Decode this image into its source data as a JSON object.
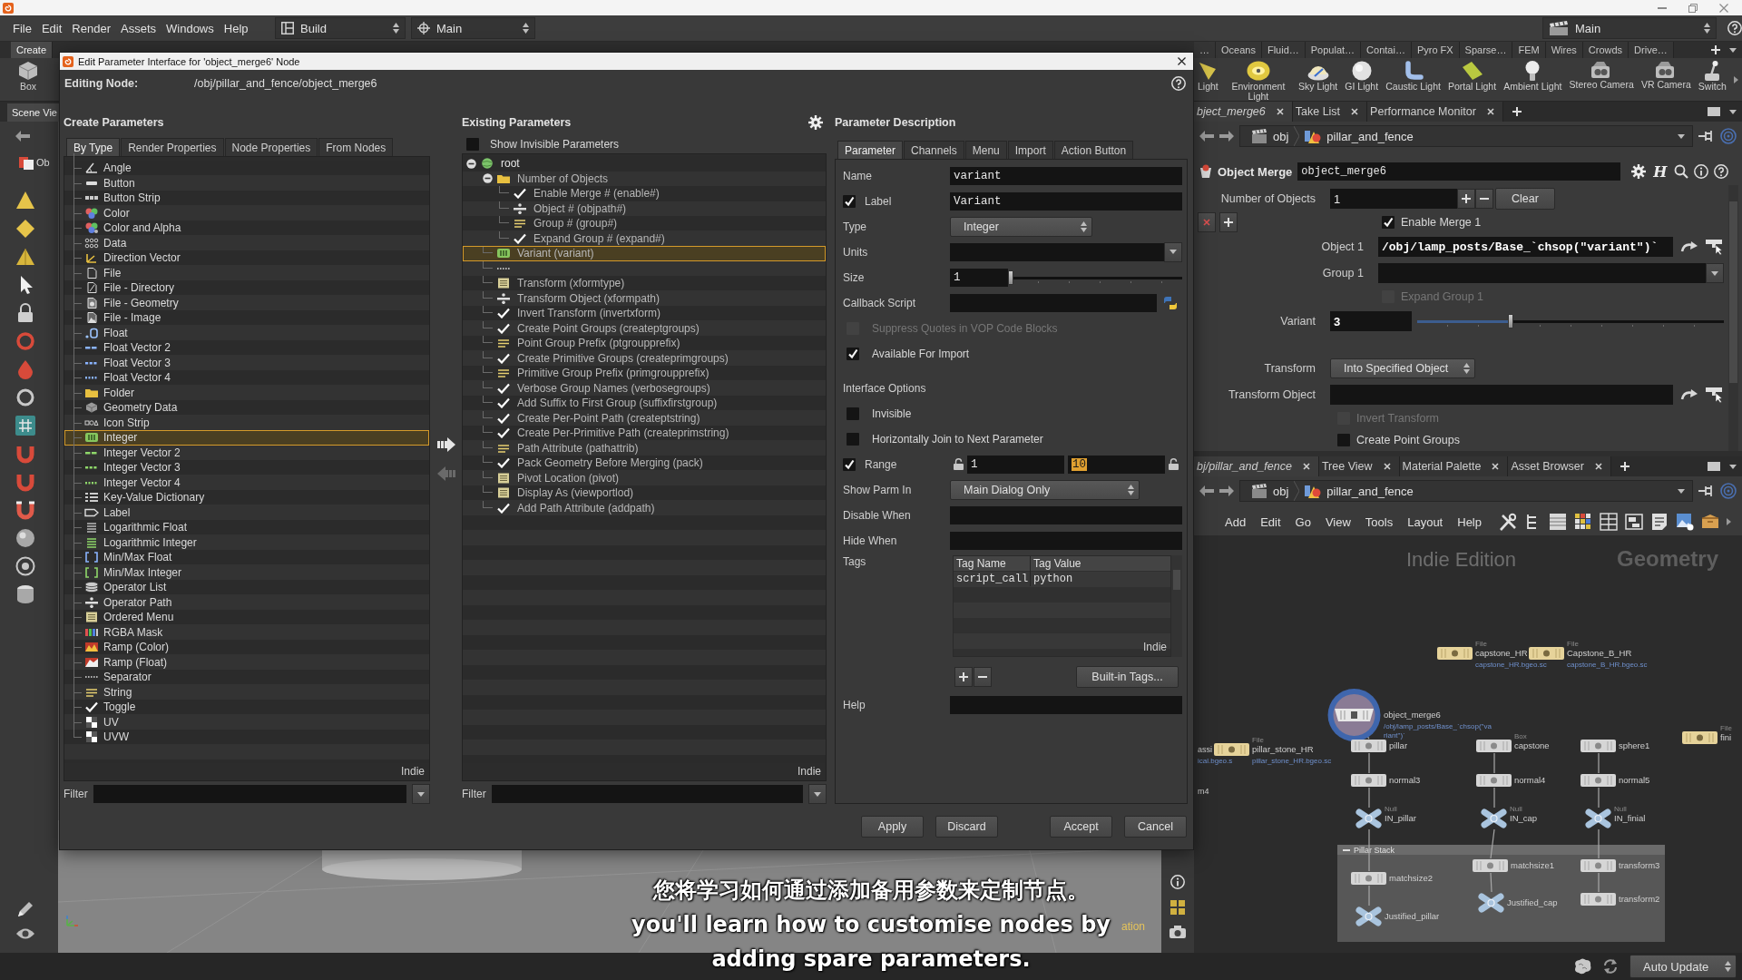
{
  "menu_bar": {
    "menus": [
      "File",
      "Edit",
      "Render",
      "Assets",
      "Windows",
      "Help"
    ],
    "desktop_selectors": [
      {
        "label": "Build",
        "kind": "layout"
      },
      {
        "label": "Main",
        "kind": "target"
      }
    ],
    "desktop_menu": {
      "label": "Main"
    }
  },
  "shelf": {
    "left_tabs": [
      {
        "label": "Create",
        "selected": true
      }
    ],
    "left_tools": [
      {
        "label": "Box",
        "kind": "box"
      }
    ],
    "tabs": [
      {
        "label": "…",
        "selected": false
      },
      {
        "label": "Oceans",
        "selected": false
      },
      {
        "label": "Fluid…",
        "selected": false
      },
      {
        "label": "Populat…",
        "selected": false
      },
      {
        "label": "Contai…",
        "selected": false
      },
      {
        "label": "Pyro FX",
        "selected": false
      },
      {
        "label": "Sparse…",
        "selected": false
      },
      {
        "label": "FEM",
        "selected": false
      },
      {
        "label": "Wires",
        "selected": false
      },
      {
        "label": "Crowds",
        "selected": false
      },
      {
        "label": "Drive…",
        "selected": false
      }
    ],
    "tools": [
      {
        "label": "Light",
        "kind": "cone"
      },
      {
        "label": "Environment Light",
        "kind": "disc"
      },
      {
        "label": "Sky Light",
        "kind": "dome"
      },
      {
        "label": "GI Light",
        "kind": "sphere"
      },
      {
        "label": "Caustic Light",
        "kind": "tube"
      },
      {
        "label": "Portal Light",
        "kind": "panel"
      },
      {
        "label": "Ambient Light",
        "kind": "bulb"
      },
      {
        "label": "Stereo Camera",
        "kind": "camera"
      },
      {
        "label": "VR Camera",
        "kind": "camera"
      },
      {
        "label": "Switch",
        "kind": "lever"
      }
    ]
  },
  "scene_view": {
    "tabs": [
      {
        "label": "Scene Vie",
        "selected": true
      }
    ],
    "context_button": "Ob",
    "hud_text": "ation"
  },
  "dialog": {
    "title": "Edit Parameter Interface for 'object_merge6' Node",
    "editing_node_label": "Editing Node:",
    "editing_node_path": "/obj/pillar_and_fence/object_merge6",
    "create_parameters": {
      "heading": "Create Parameters",
      "tabs": [
        {
          "label": "By Type",
          "selected": true
        },
        {
          "label": "Render Properties",
          "selected": false
        },
        {
          "label": "Node Properties",
          "selected": false
        },
        {
          "label": "From Nodes",
          "selected": false
        }
      ],
      "items": [
        {
          "label": "Angle",
          "kind": "angle",
          "selected": false
        },
        {
          "label": "Button",
          "kind": "button",
          "selected": false
        },
        {
          "label": "Button Strip",
          "kind": "strip",
          "selected": false
        },
        {
          "label": "Color",
          "kind": "color",
          "selected": false
        },
        {
          "label": "Color and Alpha",
          "kind": "alpha",
          "selected": false
        },
        {
          "label": "Data",
          "kind": "data",
          "selected": false
        },
        {
          "label": "Direction Vector",
          "kind": "direction",
          "selected": false
        },
        {
          "label": "File",
          "kind": "file",
          "selected": false
        },
        {
          "label": "File - Directory",
          "kind": "directory",
          "selected": false
        },
        {
          "label": "File - Geometry",
          "kind": "geofile",
          "selected": false
        },
        {
          "label": "File - Image",
          "kind": "image",
          "selected": false
        },
        {
          "label": "Float",
          "kind": "float",
          "selected": false
        },
        {
          "label": "Float Vector 2",
          "kind": "fvec2",
          "selected": false
        },
        {
          "label": "Float Vector 3",
          "kind": "fvec3",
          "selected": false
        },
        {
          "label": "Float Vector 4",
          "kind": "fvec4",
          "selected": false
        },
        {
          "label": "Folder",
          "kind": "folder",
          "selected": false
        },
        {
          "label": "Geometry Data",
          "kind": "geodata",
          "selected": false
        },
        {
          "label": "Icon Strip",
          "kind": "iconstrip",
          "selected": false
        },
        {
          "label": "Integer",
          "kind": "integer",
          "selected": true
        },
        {
          "label": "Integer Vector 2",
          "kind": "ivec2",
          "selected": false
        },
        {
          "label": "Integer Vector 3",
          "kind": "ivec3",
          "selected": false
        },
        {
          "label": "Integer Vector 4",
          "kind": "ivec4",
          "selected": false
        },
        {
          "label": "Key-Value Dictionary",
          "kind": "dict",
          "selected": false
        },
        {
          "label": "Label",
          "kind": "label",
          "selected": false
        },
        {
          "label": "Logarithmic Float",
          "kind": "logfloat",
          "selected": false
        },
        {
          "label": "Logarithmic Integer",
          "kind": "logint",
          "selected": false
        },
        {
          "label": "Min/Max Float",
          "kind": "minmaxf",
          "selected": false
        },
        {
          "label": "Min/Max Integer",
          "kind": "minmaxi",
          "selected": false
        },
        {
          "label": "Operator List",
          "kind": "oplist",
          "selected": false
        },
        {
          "label": "Operator Path",
          "kind": "oppath",
          "selected": false
        },
        {
          "label": "Ordered Menu",
          "kind": "menu",
          "selected": false
        },
        {
          "label": "RGBA Mask",
          "kind": "rgba",
          "selected": false
        },
        {
          "label": "Ramp (Color)",
          "kind": "rampcolor",
          "selected": false
        },
        {
          "label": "Ramp (Float)",
          "kind": "rampfloat",
          "selected": false
        },
        {
          "label": "Separator",
          "kind": "separator",
          "selected": false
        },
        {
          "label": "String",
          "kind": "string",
          "selected": false
        },
        {
          "label": "Toggle",
          "kind": "toggle",
          "selected": false
        },
        {
          "label": "UV",
          "kind": "uv",
          "selected": false
        },
        {
          "label": "UVW",
          "kind": "uv",
          "selected": false
        }
      ],
      "edition_mark": "Indie",
      "filter_label": "Filter"
    },
    "existing_parameters": {
      "heading": "Existing Parameters",
      "show_invisible": {
        "label": "Show Invisible Parameters",
        "checked": false
      },
      "tree": [
        {
          "label": "root",
          "kind": "root",
          "expanded": true,
          "selected": false,
          "children": [
            {
              "label": "Number of Objects",
              "kind": "folder",
              "expanded": true,
              "selected": false,
              "children": [
                {
                  "label": "Enable Merge # (enable#)",
                  "kind": "toggle",
                  "selected": false
                },
                {
                  "label": "Object # (objpath#)",
                  "kind": "oppath",
                  "selected": false
                },
                {
                  "label": "Group # (group#)",
                  "kind": "string",
                  "selected": false
                },
                {
                  "label": "Expand Group # (expand#)",
                  "kind": "toggle",
                  "selected": false
                }
              ]
            },
            {
              "label": "Variant (variant)",
              "kind": "integer",
              "selected": true
            },
            {
              "kind": "separator",
              "selected": false
            },
            {
              "label": "Transform (xformtype)",
              "kind": "menu",
              "selected": false
            },
            {
              "label": "Transform Object (xformpath)",
              "kind": "oppath",
              "selected": false
            },
            {
              "label": "Invert Transform (invertxform)",
              "kind": "toggle",
              "selected": false
            },
            {
              "label": "Create Point Groups (createptgroups)",
              "kind": "toggle",
              "selected": false
            },
            {
              "label": "Point Group Prefix (ptgroupprefix)",
              "kind": "string",
              "selected": false
            },
            {
              "label": "Create Primitive Groups (createprimgroups)",
              "kind": "toggle",
              "selected": false
            },
            {
              "label": "Primitive Group Prefix (primgroupprefix)",
              "kind": "string",
              "selected": false
            },
            {
              "label": "Verbose Group Names (verbosegroups)",
              "kind": "toggle",
              "selected": false
            },
            {
              "label": "Add Suffix to First Group (suffixfirstgroup)",
              "kind": "toggle",
              "selected": false
            },
            {
              "label": "Create Per-Point Path (createptstring)",
              "kind": "toggle",
              "selected": false
            },
            {
              "label": "Create Per-Primitive Path (createprimstring)",
              "kind": "toggle",
              "selected": false
            },
            {
              "label": "Path Attribute (pathattrib)",
              "kind": "string",
              "selected": false
            },
            {
              "label": "Pack Geometry Before Merging (pack)",
              "kind": "toggle",
              "selected": false
            },
            {
              "label": "Pivot Location (pivot)",
              "kind": "menu",
              "selected": false
            },
            {
              "label": "Display As (viewportlod)",
              "kind": "menu",
              "selected": false
            },
            {
              "label": "Add Path Attribute (addpath)",
              "kind": "toggle",
              "selected": false
            }
          ]
        }
      ],
      "edition_mark": "Indie",
      "filter_label": "Filter"
    },
    "parameter_description": {
      "heading": "Parameter Description",
      "tabs": [
        {
          "label": "Parameter",
          "selected": true
        },
        {
          "label": "Channels",
          "selected": false
        },
        {
          "label": "Menu",
          "selected": false
        },
        {
          "label": "Import",
          "selected": false
        },
        {
          "label": "Action Button",
          "selected": false
        }
      ],
      "rows": [
        {
          "kind": "text",
          "label": "Name",
          "value": "variant"
        },
        {
          "kind": "toggle_text",
          "label": "Label",
          "checked": true,
          "value": "Variant"
        },
        {
          "kind": "menu",
          "label": "Type",
          "value": "Integer"
        },
        {
          "kind": "combo",
          "label": "Units"
        },
        {
          "kind": "slider",
          "label": "Size",
          "value": "1",
          "level": 0
        },
        {
          "kind": "script",
          "label": "Callback Script"
        },
        {
          "kind": "checkbox",
          "label": "Suppress Quotes in VOP Code Blocks",
          "checked": false,
          "disabled": true
        },
        {
          "kind": "checkbox",
          "label": "Available For Import",
          "checked": true
        },
        {
          "kind": "section",
          "label": "Interface Options"
        },
        {
          "kind": "checkbox",
          "label": "Invisible",
          "checked": false
        },
        {
          "kind": "checkbox",
          "label": "Horizontally Join to Next Parameter",
          "checked": false
        },
        {
          "kind": "range",
          "label": "Range",
          "checked": true,
          "min": "1",
          "max": "10",
          "max_selected": true
        },
        {
          "kind": "menu",
          "label": "Show Parm In",
          "value": "Main Dialog Only"
        },
        {
          "kind": "text",
          "label": "Disable When"
        },
        {
          "kind": "text",
          "label": "Hide When"
        },
        {
          "kind": "tags",
          "label": "Tags",
          "columns": [
            "Tag Name",
            "Tag Value"
          ],
          "rows": [
            [
              "script_call",
              "python"
            ]
          ],
          "edition_mark": "Indie",
          "builtin_button": "Built-in Tags..."
        },
        {
          "kind": "text",
          "label": "Help"
        }
      ]
    },
    "buttons": [
      {
        "label": "Apply"
      },
      {
        "label": "Discard"
      },
      {
        "label": "Accept"
      },
      {
        "label": "Cancel"
      }
    ]
  },
  "parameter_pane": {
    "tabs": [
      {
        "label": "bject_merge6",
        "selected": true
      },
      {
        "label": "Take List",
        "selected": false
      },
      {
        "label": "Performance Monitor",
        "selected": false
      }
    ],
    "path": [
      {
        "label": "obj",
        "kind": "objects"
      },
      {
        "label": "pillar_and_fence",
        "kind": "geometry"
      }
    ],
    "node_type": "Object Merge",
    "node_name": "object_merge6",
    "asset_button": "H",
    "parameters": [
      {
        "kind": "multiparm",
        "label": "Number of Objects",
        "value": "1",
        "clear_button": "Clear"
      },
      {
        "kind": "toggle",
        "label": "Enable Merge 1",
        "checked": true,
        "instance": true,
        "instance_controls": true
      },
      {
        "kind": "path",
        "label": "Object 1",
        "value": "/obj/lamp_posts/Base_`chsop(\"variant\")`",
        "instance": true
      },
      {
        "kind": "combo",
        "label": "Group 1",
        "instance": true
      },
      {
        "kind": "toggle",
        "label": "Expand Group 1",
        "checked": false,
        "disabled": true,
        "instance": true
      },
      {
        "kind": "slider",
        "label": "Variant",
        "value": "3",
        "level": 0.3
      },
      {
        "kind": "separator"
      },
      {
        "kind": "menu",
        "label": "Transform",
        "value": "Into Specified Object"
      },
      {
        "kind": "path",
        "label": "Transform Object"
      },
      {
        "kind": "toggle",
        "label": "Invert Transform",
        "checked": false,
        "disabled": true
      },
      {
        "kind": "toggle",
        "label": "Create Point Groups",
        "checked": false
      }
    ]
  },
  "network_pane": {
    "tabs": [
      {
        "label": "bj/pillar_and_fence",
        "selected": true
      },
      {
        "label": "Tree View",
        "selected": false
      },
      {
        "label": "Material Palette",
        "selected": false
      },
      {
        "label": "Asset Browser",
        "selected": false
      }
    ],
    "path": [
      {
        "label": "obj",
        "kind": "objects"
      },
      {
        "label": "pillar_and_fence",
        "kind": "geometry"
      }
    ],
    "menus": [
      "Add",
      "Edit",
      "Go",
      "View",
      "Tools",
      "Layout",
      "Help"
    ],
    "edition_label": "Indie Edition",
    "context_label": "Geometry",
    "network_box": {
      "title": "Pillar Stack",
      "expanded": true
    },
    "nodes": [
      {
        "name": "capstone_HR",
        "kind": "file",
        "type_label": "File",
        "detail": [
          "capstone_HR.bgeo.sc"
        ],
        "selected": false
      },
      {
        "name": "Capstone_B_HR",
        "kind": "file",
        "type_label": "File",
        "detail": [
          "capstone_B_HR.bgeo.sc"
        ],
        "selected": false
      },
      {
        "name": "object_merge6",
        "kind": "merge",
        "detail": [
          "/obj/lamp_posts/Base_`chsop(\"va",
          "riant\")`"
        ],
        "selected": true
      },
      {
        "name": "assi",
        "kind": "offscreen",
        "detail": [
          "ical.bgeo.s"
        ],
        "selected": false
      },
      {
        "name": "pillar_stone_HR",
        "kind": "file",
        "type_label": "File",
        "detail": [
          "pillar_stone_HR.bgeo.sc"
        ],
        "selected": false
      },
      {
        "name": "pillar",
        "kind": "sop",
        "selected": false
      },
      {
        "name": "capstone",
        "kind": "sop",
        "type_label": "Box",
        "selected": false
      },
      {
        "name": "sphere1",
        "kind": "sop",
        "selected": false
      },
      {
        "name": "normal3",
        "kind": "sop",
        "selected": false
      },
      {
        "name": "normal4",
        "kind": "sop",
        "selected": false
      },
      {
        "name": "normal5",
        "kind": "sop",
        "selected": false
      },
      {
        "name": "IN_pillar",
        "kind": "null",
        "type_label": "Null",
        "selected": false
      },
      {
        "name": "IN_cap",
        "kind": "null",
        "type_label": "Null",
        "selected": false
      },
      {
        "name": "IN_finial",
        "kind": "null",
        "type_label": "Null",
        "selected": false
      },
      {
        "name": "fini",
        "kind": "file",
        "type_label": "File",
        "selected": false
      },
      {
        "name": "m4",
        "kind": "offscreen",
        "selected": false
      },
      {
        "name": "matchsize2",
        "kind": "sop",
        "selected": false
      },
      {
        "name": "matchsize1",
        "kind": "sop",
        "selected": false
      },
      {
        "name": "transform3",
        "kind": "sop",
        "selected": false
      },
      {
        "name": "transform2",
        "kind": "sop",
        "selected": false
      },
      {
        "name": "Justified_pillar",
        "kind": "null",
        "selected": false
      },
      {
        "name": "Justified_cap",
        "kind": "null",
        "selected": false
      }
    ]
  },
  "status_bar": {
    "update_mode": "Auto Update"
  },
  "subtitles": [
    "您将学习如何通过添加备用参数来定制节点。",
    "you'll learn how to customise nodes by",
    "adding spare parameters."
  ]
}
